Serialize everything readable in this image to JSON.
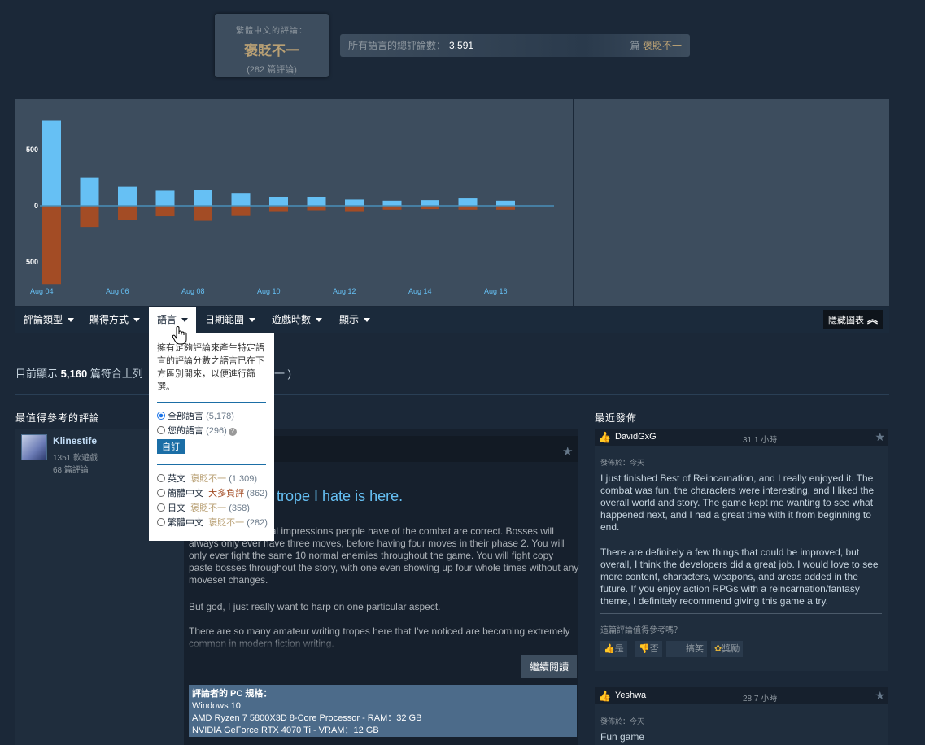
{
  "score": {
    "language_label": "繁體中文的評論：",
    "language_value": "褒貶不一",
    "language_count": "(282 篇評論)",
    "total_label": "所有語言的總評論數：",
    "total_value": "3,591",
    "total_suffix": "篇",
    "total_rating": "褒貶不一"
  },
  "chart_data": {
    "type": "bar",
    "categories": [
      "Aug 04",
      "Aug 05",
      "Aug 06",
      "Aug 07",
      "Aug 08",
      "Aug 09",
      "Aug 10",
      "Aug 11",
      "Aug 12",
      "Aug 13",
      "Aug 14",
      "Aug 15",
      "Aug 16"
    ],
    "x_tick_labels": [
      "Aug 04",
      "Aug 06",
      "Aug 08",
      "Aug 10",
      "Aug 12",
      "Aug 14",
      "Aug 16"
    ],
    "y_tick_labels": [
      "500",
      "0",
      "500"
    ],
    "ylim": [
      -700,
      780
    ],
    "series": [
      {
        "values": [
          760,
          250,
          170,
          135,
          140,
          115,
          80,
          80,
          55,
          45,
          50,
          65,
          45
        ],
        "color": "#66c0f4"
      },
      {
        "values": [
          -700,
          -190,
          -130,
          -95,
          -135,
          -85,
          -55,
          -40,
          -55,
          -35,
          -30,
          -35,
          -35
        ],
        "color": "#a34c25"
      }
    ]
  },
  "filters": {
    "items": [
      "評論類型",
      "購得方式",
      "語言",
      "日期範圍",
      "遊戲時數",
      "顯示"
    ],
    "hide_chart": "隱藏圖表"
  },
  "lang_dropdown": {
    "description": "擁有足夠評論來產生特定語言的評論分數之語言已在下方區別開來，以便進行篩選。",
    "all_languages": "全部語言",
    "all_count": "(5,178)",
    "your_languages": "您的語言",
    "your_count": "(296)",
    "customize": "自訂",
    "languages": [
      {
        "name": "英文",
        "rating": "褒貶不一",
        "count": "(1,309)"
      },
      {
        "name": "簡體中文",
        "rating": "大多負評",
        "count": "(862)"
      },
      {
        "name": "日文",
        "rating": "褒貶不一",
        "count": "(358)"
      },
      {
        "name": "繁體中文",
        "rating": "褒貶不一",
        "count": "(282)"
      }
    ]
  },
  "showing": {
    "prefix": "目前顯示",
    "count": "5,160",
    "suffix": "篇符合上列",
    "tail": "一 )"
  },
  "sections": {
    "helpful": "最值得參考的評論",
    "recent": "最近發佈"
  },
  "helpful_review": {
    "name": "Klinestife",
    "games": "1351 款遊戲",
    "reviews": "68 篇評論",
    "title": "trope I hate is here.",
    "p1": "hat most of the initial impressions people have of the combat are correct. Bosses will always only ever have three moves, before having four moves in their phase 2. You will only ever fight the same 10 normal enemies throughout the game. You will fight copy paste bosses throughout the story, with one even showing up four whole times without any moveset changes.",
    "p2": "But god, I just really want to harp on one particular aspect.",
    "p3": "There are so many amateur writing tropes here that I've noticed are becoming extremely common in modern fiction writing.",
    "read_more": "繼續閱讀",
    "specs_title": "評論者的 PC 規格：",
    "specs_os": "Windows 10",
    "specs_cpu": "AMD Ryzen 7 5800X3D 8-Core Processor - RAM：32 GB",
    "specs_gpu": "NVIDIA GeForce RTX 4070 Ti - VRAM：12 GB"
  },
  "recent_reviews": [
    {
      "name": "DavidGxG",
      "hours": "31.1 小時",
      "posted": "發佈於：今天",
      "p1": "I just finished Best of Reincarnation, and I really enjoyed it. The combat was fun, the characters were interesting, and I liked the overall world and story. The game kept me wanting to see what happened next, and I had a great time with it from beginning to end.",
      "p2": "There are definitely a few things that could be improved, but overall, I think the developers did a great job. I would love to see more content, characters, weapons, and areas added in the future. If you enjoy action RPGs with a reincarnation/fantasy theme, I definitely recommend giving this game a try.",
      "ask": "這篇評論值得參考嗎？",
      "yes": "是",
      "no": "否",
      "funny": "搞笑",
      "award": "獎勵"
    },
    {
      "name": "Yeshwa",
      "hours": "28.7 小時",
      "posted": "發佈於：今天",
      "p1": "Fun game"
    }
  ]
}
